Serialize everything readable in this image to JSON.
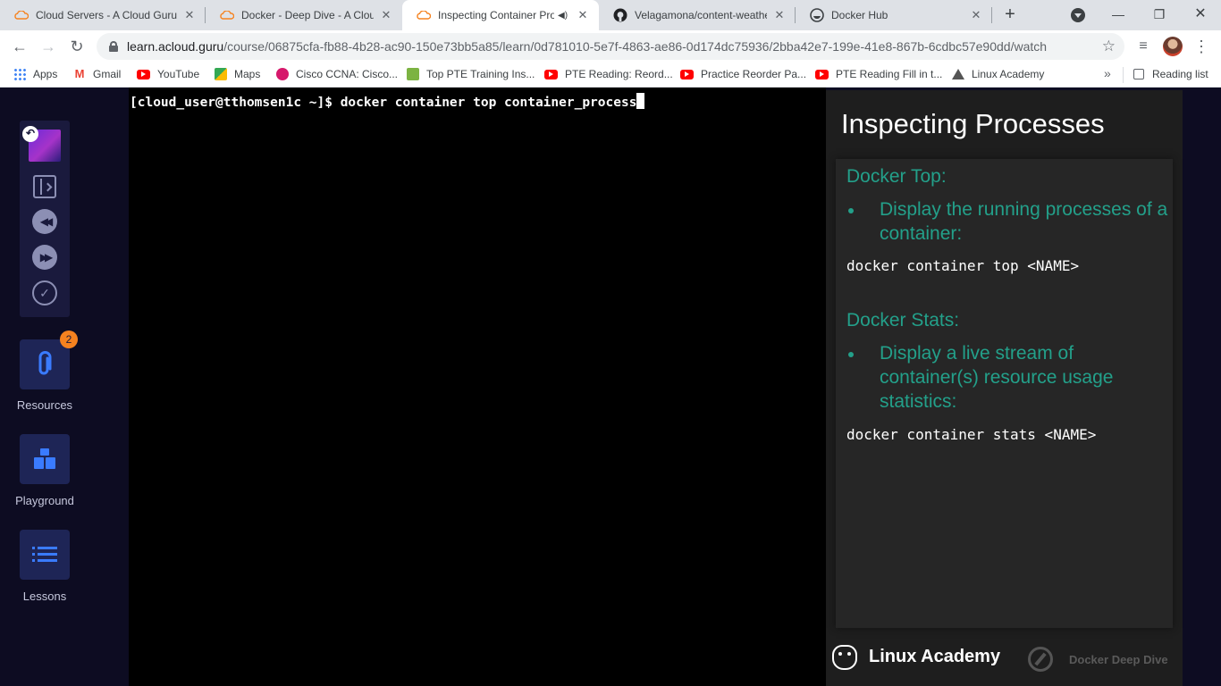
{
  "browser": {
    "tabs": [
      {
        "title": "Cloud Servers - A Cloud Guru",
        "icon": "acloudguru-icon",
        "active": false
      },
      {
        "title": "Docker - Deep Dive - A Cloud",
        "icon": "acloudguru-icon",
        "active": false
      },
      {
        "title": "Inspecting Container Pro",
        "icon": "acloudguru-icon",
        "active": true,
        "audio": "speaker-icon"
      },
      {
        "title": "Velagamona/content-weathe",
        "icon": "github-icon",
        "active": false
      },
      {
        "title": "Docker Hub",
        "icon": "dockerhub-icon",
        "active": false
      }
    ],
    "close_glyph": "✕",
    "url_host": "learn.acloud.guru",
    "url_path": "/course/06875cfa-fb88-4b28-ac90-150e73bb5a85/learn/0d781010-5e7f-4863-ae86-0d174dc75936/2bba42e7-199e-41e8-867b-6cdbc57e90dd/watch",
    "bookmarks": [
      {
        "label": "Apps",
        "icon": "apps-icon"
      },
      {
        "label": "Gmail",
        "icon": "gmail-icon"
      },
      {
        "label": "YouTube",
        "icon": "youtube-icon"
      },
      {
        "label": "Maps",
        "icon": "maps-icon"
      },
      {
        "label": "Cisco CCNA: Cisco...",
        "icon": "cisco-icon"
      },
      {
        "label": "Top PTE Training Ins...",
        "icon": "pte-icon"
      },
      {
        "label": "PTE Reading: Reord...",
        "icon": "youtube-icon"
      },
      {
        "label": "Practice Reorder Pa...",
        "icon": "youtube-icon"
      },
      {
        "label": "PTE Reading Fill in t...",
        "icon": "youtube-icon"
      },
      {
        "label": "Linux Academy",
        "icon": "linux-academy-icon"
      }
    ],
    "more_bookmarks": "»",
    "reading_list": "Reading list"
  },
  "sidebar": {
    "badge_count": "2",
    "nav": [
      {
        "label": "Resources",
        "icon": "paperclip-icon"
      },
      {
        "label": "Playground",
        "icon": "cubes-icon"
      },
      {
        "label": "Lessons",
        "icon": "list-icon"
      }
    ]
  },
  "terminal": {
    "prompt": "[cloud_user@tthomsen1c ~]$ ",
    "command": "docker container top container_process"
  },
  "slide": {
    "title": "Inspecting Processes",
    "sections": [
      {
        "heading": "Docker Top:",
        "bullet": "Display the running processes of a container:",
        "code": "docker container top <NAME>"
      },
      {
        "heading": "Docker Stats:",
        "bullet": "Display a live stream of container(s) resource usage statistics:",
        "code": "docker container stats <NAME>"
      }
    ],
    "footer_brand": "Linux Academy",
    "footer_course": "Docker Deep Dive"
  }
}
